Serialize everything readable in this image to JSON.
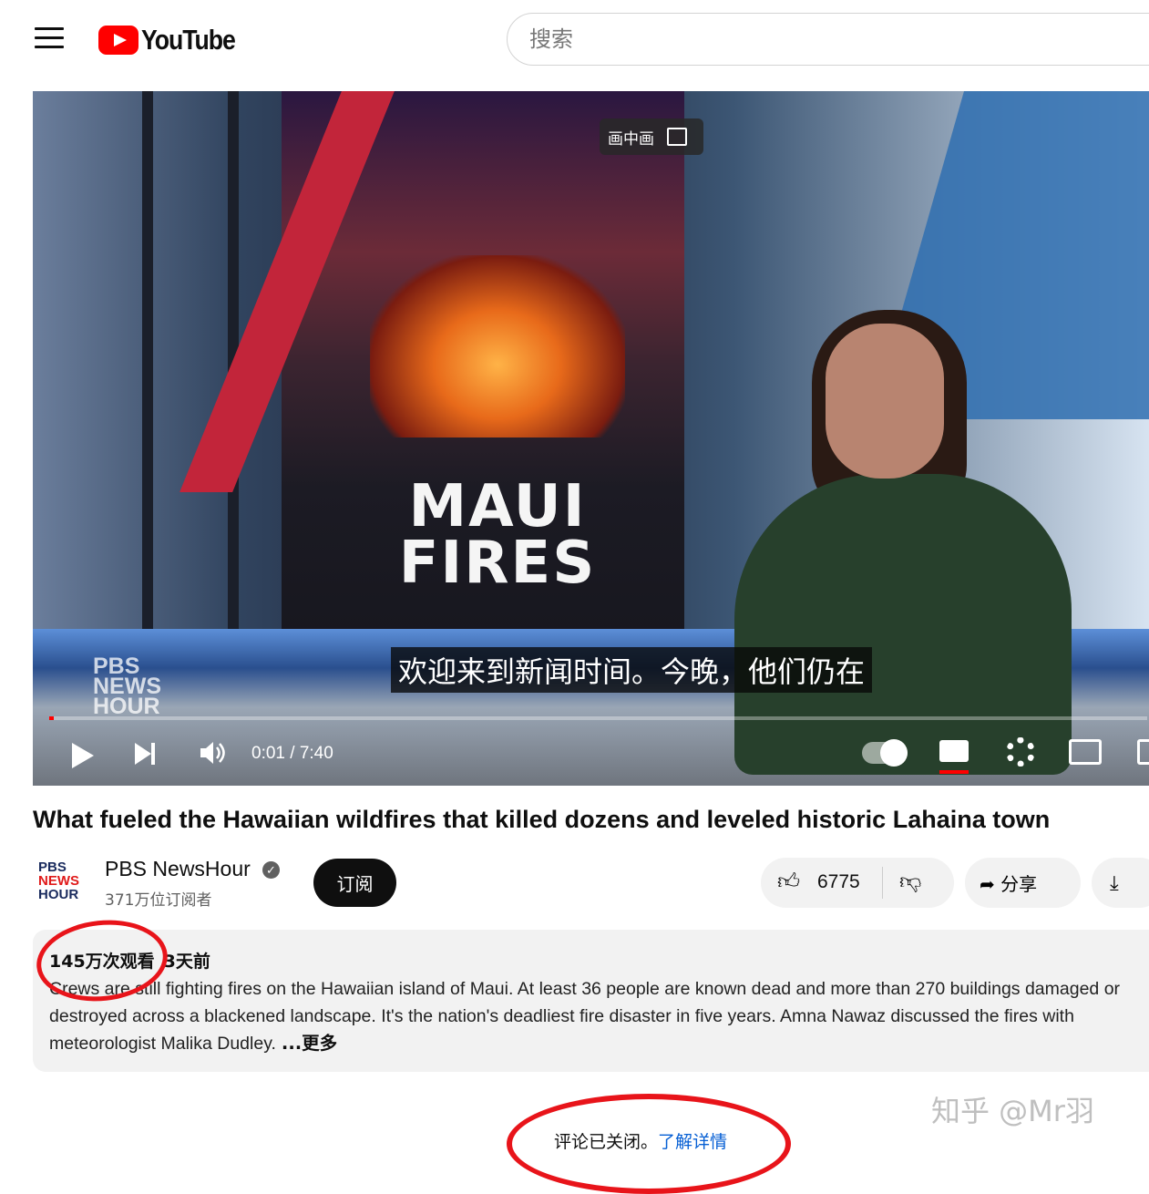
{
  "header": {
    "logo_text": "YouTube",
    "search_placeholder": "搜索"
  },
  "player": {
    "pip_label": "画中画",
    "overlay_title_line1": "MAUI",
    "overlay_title_line2": "FIRES",
    "brand_line1": "PBS",
    "brand_line2": "NEWS",
    "brand_line3": "HOUR",
    "subtitle": "欢迎来到新闻时间。今晚，他们仍在",
    "time": "0:01 / 7:40",
    "progress": 0.002
  },
  "video": {
    "title": "What fueled the Hawaiian wildfires that killed dozens and leveled historic Lahaina town"
  },
  "channel": {
    "logo_line1": "PBS",
    "logo_line2": "NEWS",
    "logo_line3": "HOUR",
    "name": "PBS NewsHour",
    "verified_mark": "✓",
    "subscribers": "371万位订阅者",
    "subscribe_label": "订阅"
  },
  "actions": {
    "like_count": "6775",
    "share_label": "分享"
  },
  "description": {
    "views": "145万次观看",
    "date": "3天前",
    "text": "Crews are still fighting fires on the Hawaiian island of Maui. At least 36 people are known dead and more than 270 buildings damaged or destroyed across a blackened landscape. It's the nation's deadliest fire disaster in five years. Amna Nawaz discussed the fires with meteorologist Malika Dudley.",
    "more_label": "...更多"
  },
  "comments": {
    "closed_text": "评论已关闭。",
    "learn_more": "了解详情"
  },
  "watermark": "知乎 @Mr羽",
  "colors": {
    "brand_red": "#ff0000",
    "link_blue": "#065fd4",
    "annotation_red": "#e8141a"
  }
}
